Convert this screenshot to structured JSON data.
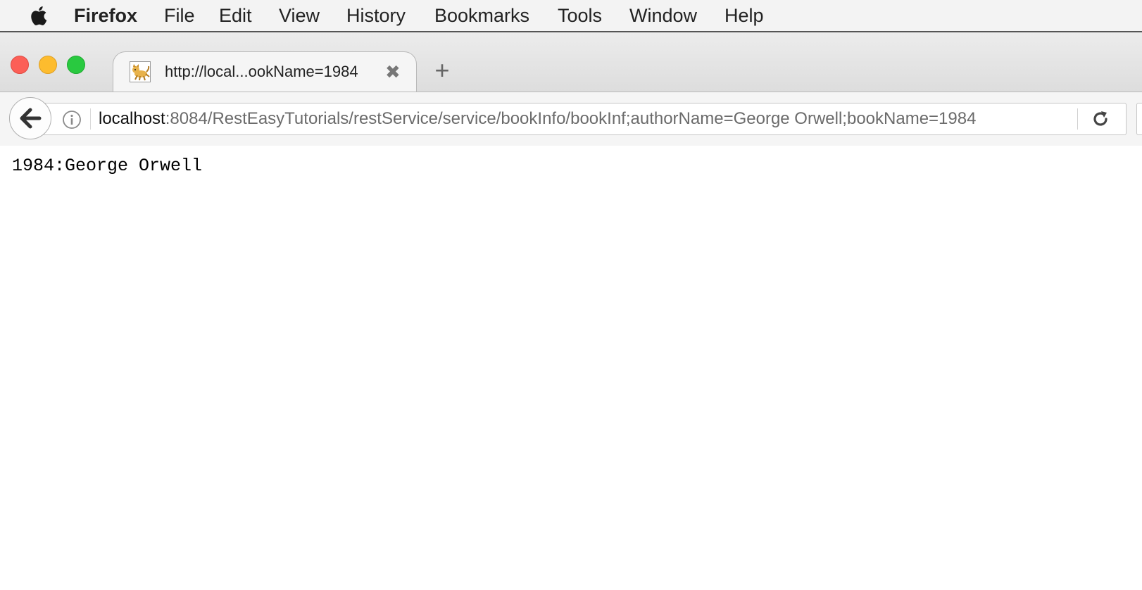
{
  "menubar": {
    "app_name": "Firefox",
    "items": [
      "File",
      "Edit",
      "View",
      "History",
      "Bookmarks",
      "Tools",
      "Window",
      "Help"
    ]
  },
  "tab": {
    "title": "http://local...ookName=1984",
    "close_glyph": "✖",
    "favicon": "tomcat-icon"
  },
  "new_tab_glyph": "+",
  "urlbar": {
    "host": "localhost",
    "path": ":8084/RestEasyTutorials/restService/service/bookInfo/bookInf;authorName=George Orwell;bookName=1984"
  },
  "page": {
    "text": "1984:George Orwell"
  },
  "colors": {
    "traffic_close": "#fc5f57",
    "traffic_minimize": "#fdbc2e",
    "traffic_maximize": "#29c940"
  }
}
